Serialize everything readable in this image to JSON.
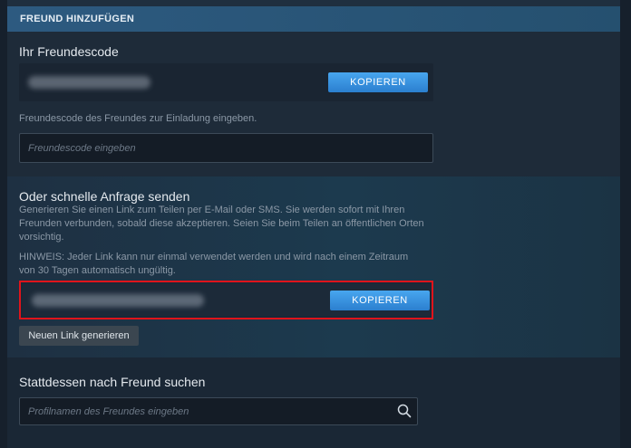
{
  "header": {
    "title": "FREUND HINZUFÜGEN"
  },
  "friend_code_section": {
    "title": "Ihr Freundescode",
    "copy_button": "KOPIEREN",
    "instruction": "Freundescode des Freundes zur Einladung eingeben.",
    "input_placeholder": "Freundescode eingeben"
  },
  "quick_invite_section": {
    "title": "Oder schnelle Anfrage senden",
    "description_lines": [
      "Generieren Sie einen Link zum Teilen per E-Mail oder SMS. Sie werden sofort mit Ihren",
      "Freunden verbunden, sobald diese akzeptieren. Seien Sie beim Teilen an öffentlichen Orten",
      "vorsichtig."
    ],
    "note_lines": [
      "HINWEIS: Jeder Link kann nur einmal verwendet werden und wird nach einem Zeitraum",
      "von 30 Tagen automatisch ungültig."
    ],
    "copy_button": "KOPIEREN",
    "generate_button": "Neuen Link generieren"
  },
  "search_section": {
    "title": "Stattdessen nach Freund suchen",
    "input_placeholder": "Profilnamen des Freundes eingeben",
    "icon": "search-icon"
  },
  "colors": {
    "accent_blue": "#3d93e5",
    "highlight_red": "#e0141b",
    "header_bg": "#2a5478"
  }
}
